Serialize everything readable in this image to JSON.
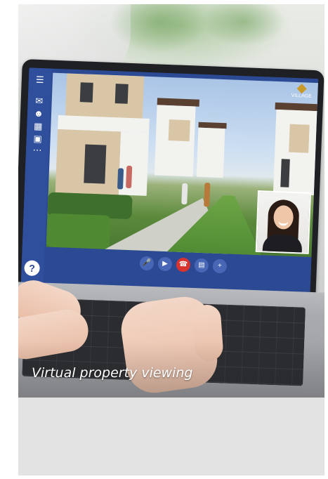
{
  "card": {
    "caption": "Virtual property viewing"
  },
  "video_call": {
    "sidebar_icons": [
      "menu-icon",
      "chat-icon",
      "participants-icon",
      "calendar-icon",
      "folder-icon",
      "more-icon"
    ],
    "help_icon": "?",
    "controls": [
      "mic-off-icon",
      "camera-icon",
      "end-call-icon",
      "share-screen-icon",
      "add-user-icon"
    ],
    "logo_text": "VILLAGE",
    "colors": {
      "panel": "#2c4a94",
      "end_call": "#d9332f",
      "background": "#e3e3e4"
    }
  }
}
